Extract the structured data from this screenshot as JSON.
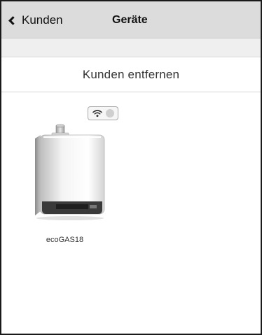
{
  "header": {
    "back_label": "Kunden",
    "title": "Geräte"
  },
  "actions": {
    "remove_customer_label": "Kunden entfernen"
  },
  "devices": [
    {
      "name": "ecoGAS18",
      "icon": "wifi-icon",
      "status_indicator": "grey"
    }
  ],
  "colors": {
    "header_bg": "#dcdcdc",
    "strip_bg": "#efefef",
    "status_dot": "#cfcfcf"
  }
}
